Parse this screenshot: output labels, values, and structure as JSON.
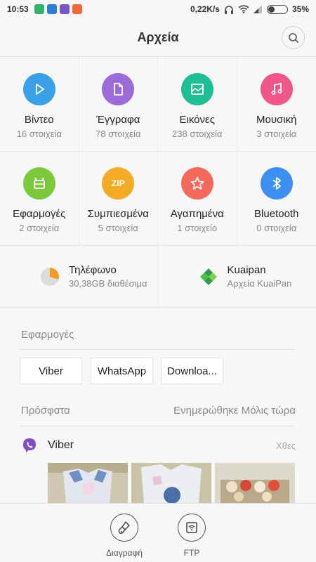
{
  "status_bar": {
    "time": "10:53",
    "network_speed": "0,22K/s",
    "battery": "35%",
    "battery_level": 0.35
  },
  "header": {
    "title": "Αρχεία"
  },
  "categories": [
    {
      "label": "Βίντεο",
      "count": "16 στοιχεία",
      "color": "#3aa0e8",
      "icon": "play-icon"
    },
    {
      "label": "Έγγραφα",
      "count": "78 στοιχεία",
      "color": "#9b6bd9",
      "icon": "document-icon"
    },
    {
      "label": "Εικόνες",
      "count": "238 στοιχεία",
      "color": "#1fbf96",
      "icon": "image-icon"
    },
    {
      "label": "Μουσική",
      "count": "3 στοιχεία",
      "color": "#f0558c",
      "icon": "music-icon"
    },
    {
      "label": "Εφαρμογές",
      "count": "2 στοιχεία",
      "color": "#7cc93e",
      "icon": "android-icon"
    },
    {
      "label": "Συμπιεσμένα",
      "count": "5 στοιχεία",
      "color": "#f3ab25",
      "icon": "zip-icon",
      "badge": "ZIP"
    },
    {
      "label": "Αγαπημένα",
      "count": "1 στοιχείο",
      "color": "#f36a5a",
      "icon": "star-icon"
    },
    {
      "label": "Bluetooth",
      "count": "0 στοιχεία",
      "color": "#3d8ff0",
      "icon": "bluetooth-icon"
    }
  ],
  "storage": [
    {
      "title": "Τηλέφωνο",
      "subtitle": "30,38GB διαθέσιμα",
      "icon": "storage-pie-icon",
      "used_fraction": 0.3
    },
    {
      "title": "Kuaipan",
      "subtitle": "Αρχεία KuaiPan",
      "icon": "kuaipan-icon"
    }
  ],
  "apps_section": {
    "label": "Εφαρμογές",
    "chips": [
      "Viber",
      "WhatsApp",
      "Downloa..."
    ]
  },
  "recent": {
    "label": "Πρόσφατα",
    "updated": "Ενημερώθηκε Μόλις τώρα",
    "app": "Viber",
    "when": "Χθες"
  },
  "bottom_bar": {
    "clean": "Διαγραφή",
    "ftp": "FTP"
  }
}
